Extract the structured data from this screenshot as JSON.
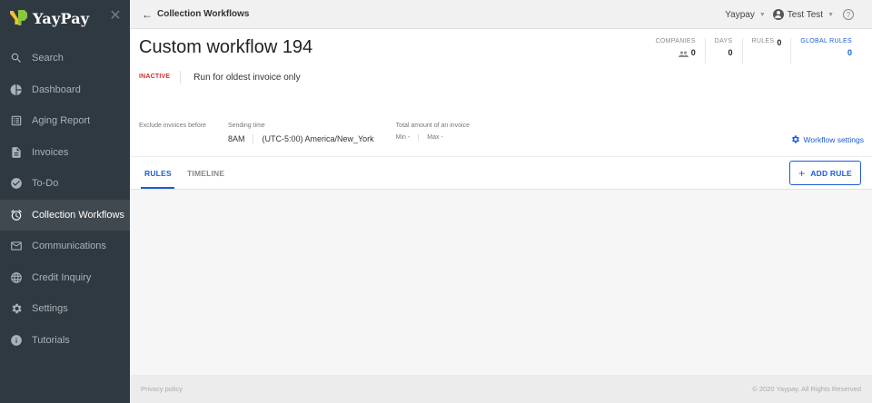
{
  "brand": {
    "name": "YayPay"
  },
  "sidebar": {
    "items": [
      {
        "label": "Search",
        "icon": "search-icon"
      },
      {
        "label": "Dashboard",
        "icon": "pie-chart-icon"
      },
      {
        "label": "Aging Report",
        "icon": "report-icon"
      },
      {
        "label": "Invoices",
        "icon": "document-icon"
      },
      {
        "label": "To-Do",
        "icon": "check-circle-icon"
      },
      {
        "label": "Collection Workflows",
        "icon": "alarm-clock-icon",
        "active": true
      },
      {
        "label": "Communications",
        "icon": "mail-icon"
      },
      {
        "label": "Credit Inquiry",
        "icon": "globe-icon"
      },
      {
        "label": "Settings",
        "icon": "gear-icon"
      },
      {
        "label": "Tutorials",
        "icon": "info-icon"
      }
    ]
  },
  "topbar": {
    "back_label": "Collection Workflows",
    "company": "Yaypay",
    "user": "Test Test"
  },
  "workflow": {
    "title": "Custom workflow 194",
    "status": "INACTIVE",
    "mode": "Run for oldest invoice only",
    "stats": {
      "companies_label": "COMPANIES",
      "companies_value": "0",
      "days_label": "DAYS",
      "days_value": "0",
      "rules_label": "RULES",
      "rules_value": "0",
      "global_rules_label": "GLOBAL RULES",
      "global_rules_value": "0"
    },
    "fields": {
      "exclude_label": "Exclude invoices before",
      "sending_label": "Sending time",
      "sending_time": "8AM",
      "timezone": "(UTC-5:00) America/New_York",
      "total_label": "Total amount of an invoice",
      "min": "Min -",
      "max": "Max -"
    },
    "settings_label": "Workflow settings"
  },
  "tabs": {
    "rules": "RULES",
    "timeline": "TIMELINE",
    "add_rule": "ADD RULE"
  },
  "footer": {
    "privacy": "Privacy policy",
    "copyright": "© 2020 Yaypay. All Rights Reserved"
  },
  "colors": {
    "sidebar_bg": "#2f3941",
    "accent": "#1e5bd6",
    "inactive": "#d0312d"
  }
}
